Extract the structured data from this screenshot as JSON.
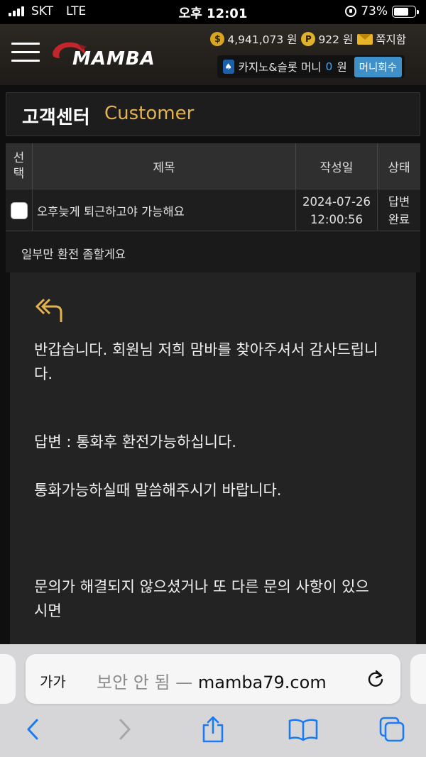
{
  "status_bar": {
    "carrier": "SKT",
    "network": "LTE",
    "time": "오후 12:01",
    "battery": "73%",
    "battery_level": 0.73
  },
  "header": {
    "logo_text": "MAMBA",
    "money_amount": "4,941,073 원",
    "point_amount": "922 원",
    "point_badge": "P",
    "mail_label": "쪽지함",
    "casino_label": "카지노&슬롯 머니",
    "casino_value": "0",
    "casino_unit": "원",
    "recover_button": "머니회수"
  },
  "page": {
    "title_ko": "고객센터",
    "title_en": "Customer"
  },
  "table": {
    "headers": {
      "select": "선택",
      "subject": "제목",
      "date": "작성일",
      "status": "상태"
    },
    "rows": [
      {
        "subject": "오후늦게 퇴근하고야 가능해요",
        "date": "2024-07-26",
        "time": "12:00:56",
        "status": "답변완료"
      }
    ]
  },
  "question": "일부만 환전 좀할게요",
  "answer": {
    "line1": "반갑습니다. 회원님 저희 맘바를 찾아주셔서 감사드립니",
    "line1b": "다.",
    "line2": "답변 : 통화후 환전가능하십니다.",
    "line3": "통화가능하실때 말씀해주시기 바랍니다.",
    "line4": "문의가 해결되지 않으셨거나 또 다른 문의 사항이 있으",
    "line4b": "시면"
  },
  "safari": {
    "text_size_button": "가가",
    "security_text": "보안 안 됨 —",
    "host": "mamba79.com"
  },
  "colors": {
    "accent_gold": "#e3b24f",
    "recover_blue": "#3f8fc9",
    "ios_blue": "#1a7cf5"
  }
}
